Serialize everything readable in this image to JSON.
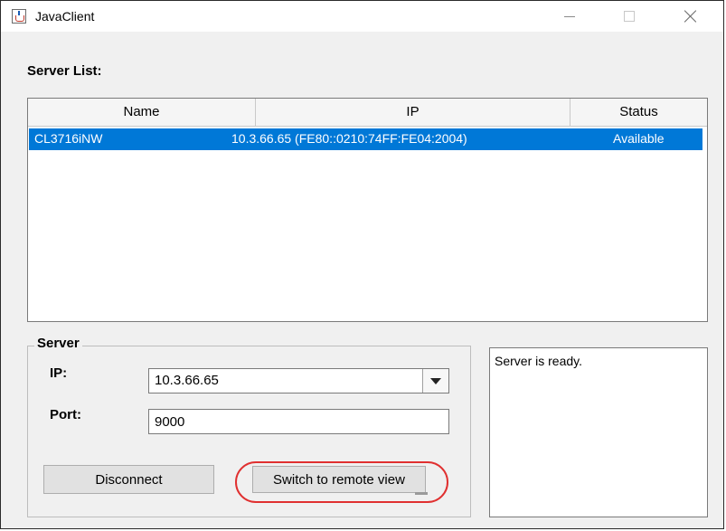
{
  "window": {
    "title": "JavaClient",
    "controls": {
      "minimize": "minimize-icon",
      "maximize": "maximize-icon",
      "close": "close-icon"
    }
  },
  "server_list": {
    "label": "Server List:",
    "columns": [
      "Name",
      "IP",
      "Status"
    ],
    "rows": [
      {
        "name": "CL3716iNW",
        "ip": "10.3.66.65 (FE80::0210:74FF:FE04:2004)",
        "status": "Available",
        "selected": true
      }
    ]
  },
  "server": {
    "legend": "Server",
    "ip_label": "IP:",
    "ip_value": "10.3.66.65",
    "port_label": "Port:",
    "port_value": "9000",
    "disconnect_label": "Disconnect",
    "switch_label": "Switch to remote view"
  },
  "status_message": "Server is ready.",
  "colors": {
    "selection": "#0078d7",
    "highlight_circle": "#e03030"
  }
}
